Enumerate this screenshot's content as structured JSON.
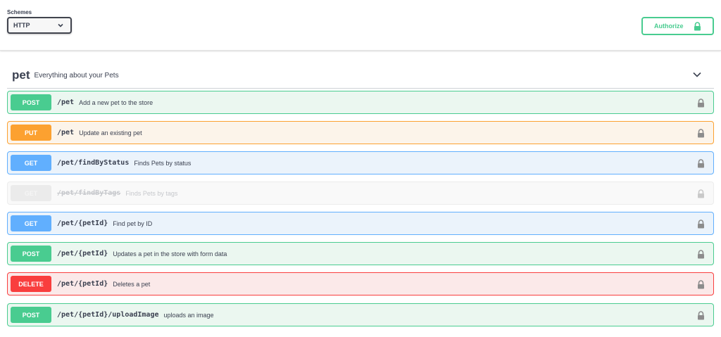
{
  "schemes": {
    "label": "Schemes",
    "selected": "HTTP"
  },
  "authorize": {
    "label": "Authorize"
  },
  "tag": {
    "name": "pet",
    "description": "Everything about your Pets"
  },
  "operations": [
    {
      "method": "POST",
      "path": "/pet",
      "summary": "Add a new pet to the store"
    },
    {
      "method": "PUT",
      "path": "/pet",
      "summary": "Update an existing pet"
    },
    {
      "method": "GET",
      "path": "/pet/findByStatus",
      "summary": "Finds Pets by status"
    },
    {
      "method": "GET",
      "path": "/pet/findByTags",
      "summary": "Finds Pets by tags"
    },
    {
      "method": "GET",
      "path": "/pet/{petId}",
      "summary": "Find pet by ID"
    },
    {
      "method": "POST",
      "path": "/pet/{petId}",
      "summary": "Updates a pet in the store with form data"
    },
    {
      "method": "DELETE",
      "path": "/pet/{petId}",
      "summary": "Deletes a pet"
    },
    {
      "method": "POST",
      "path": "/pet/{petId}/uploadImage",
      "summary": "uploads an image"
    }
  ],
  "colors": {
    "post": "#49cc90",
    "put": "#fca130",
    "get": "#61affe",
    "delete": "#f93e3e",
    "deprecated": "#ebebeb"
  },
  "icons": {
    "lock": "lock-icon",
    "chevron": "chevron-down-icon"
  }
}
